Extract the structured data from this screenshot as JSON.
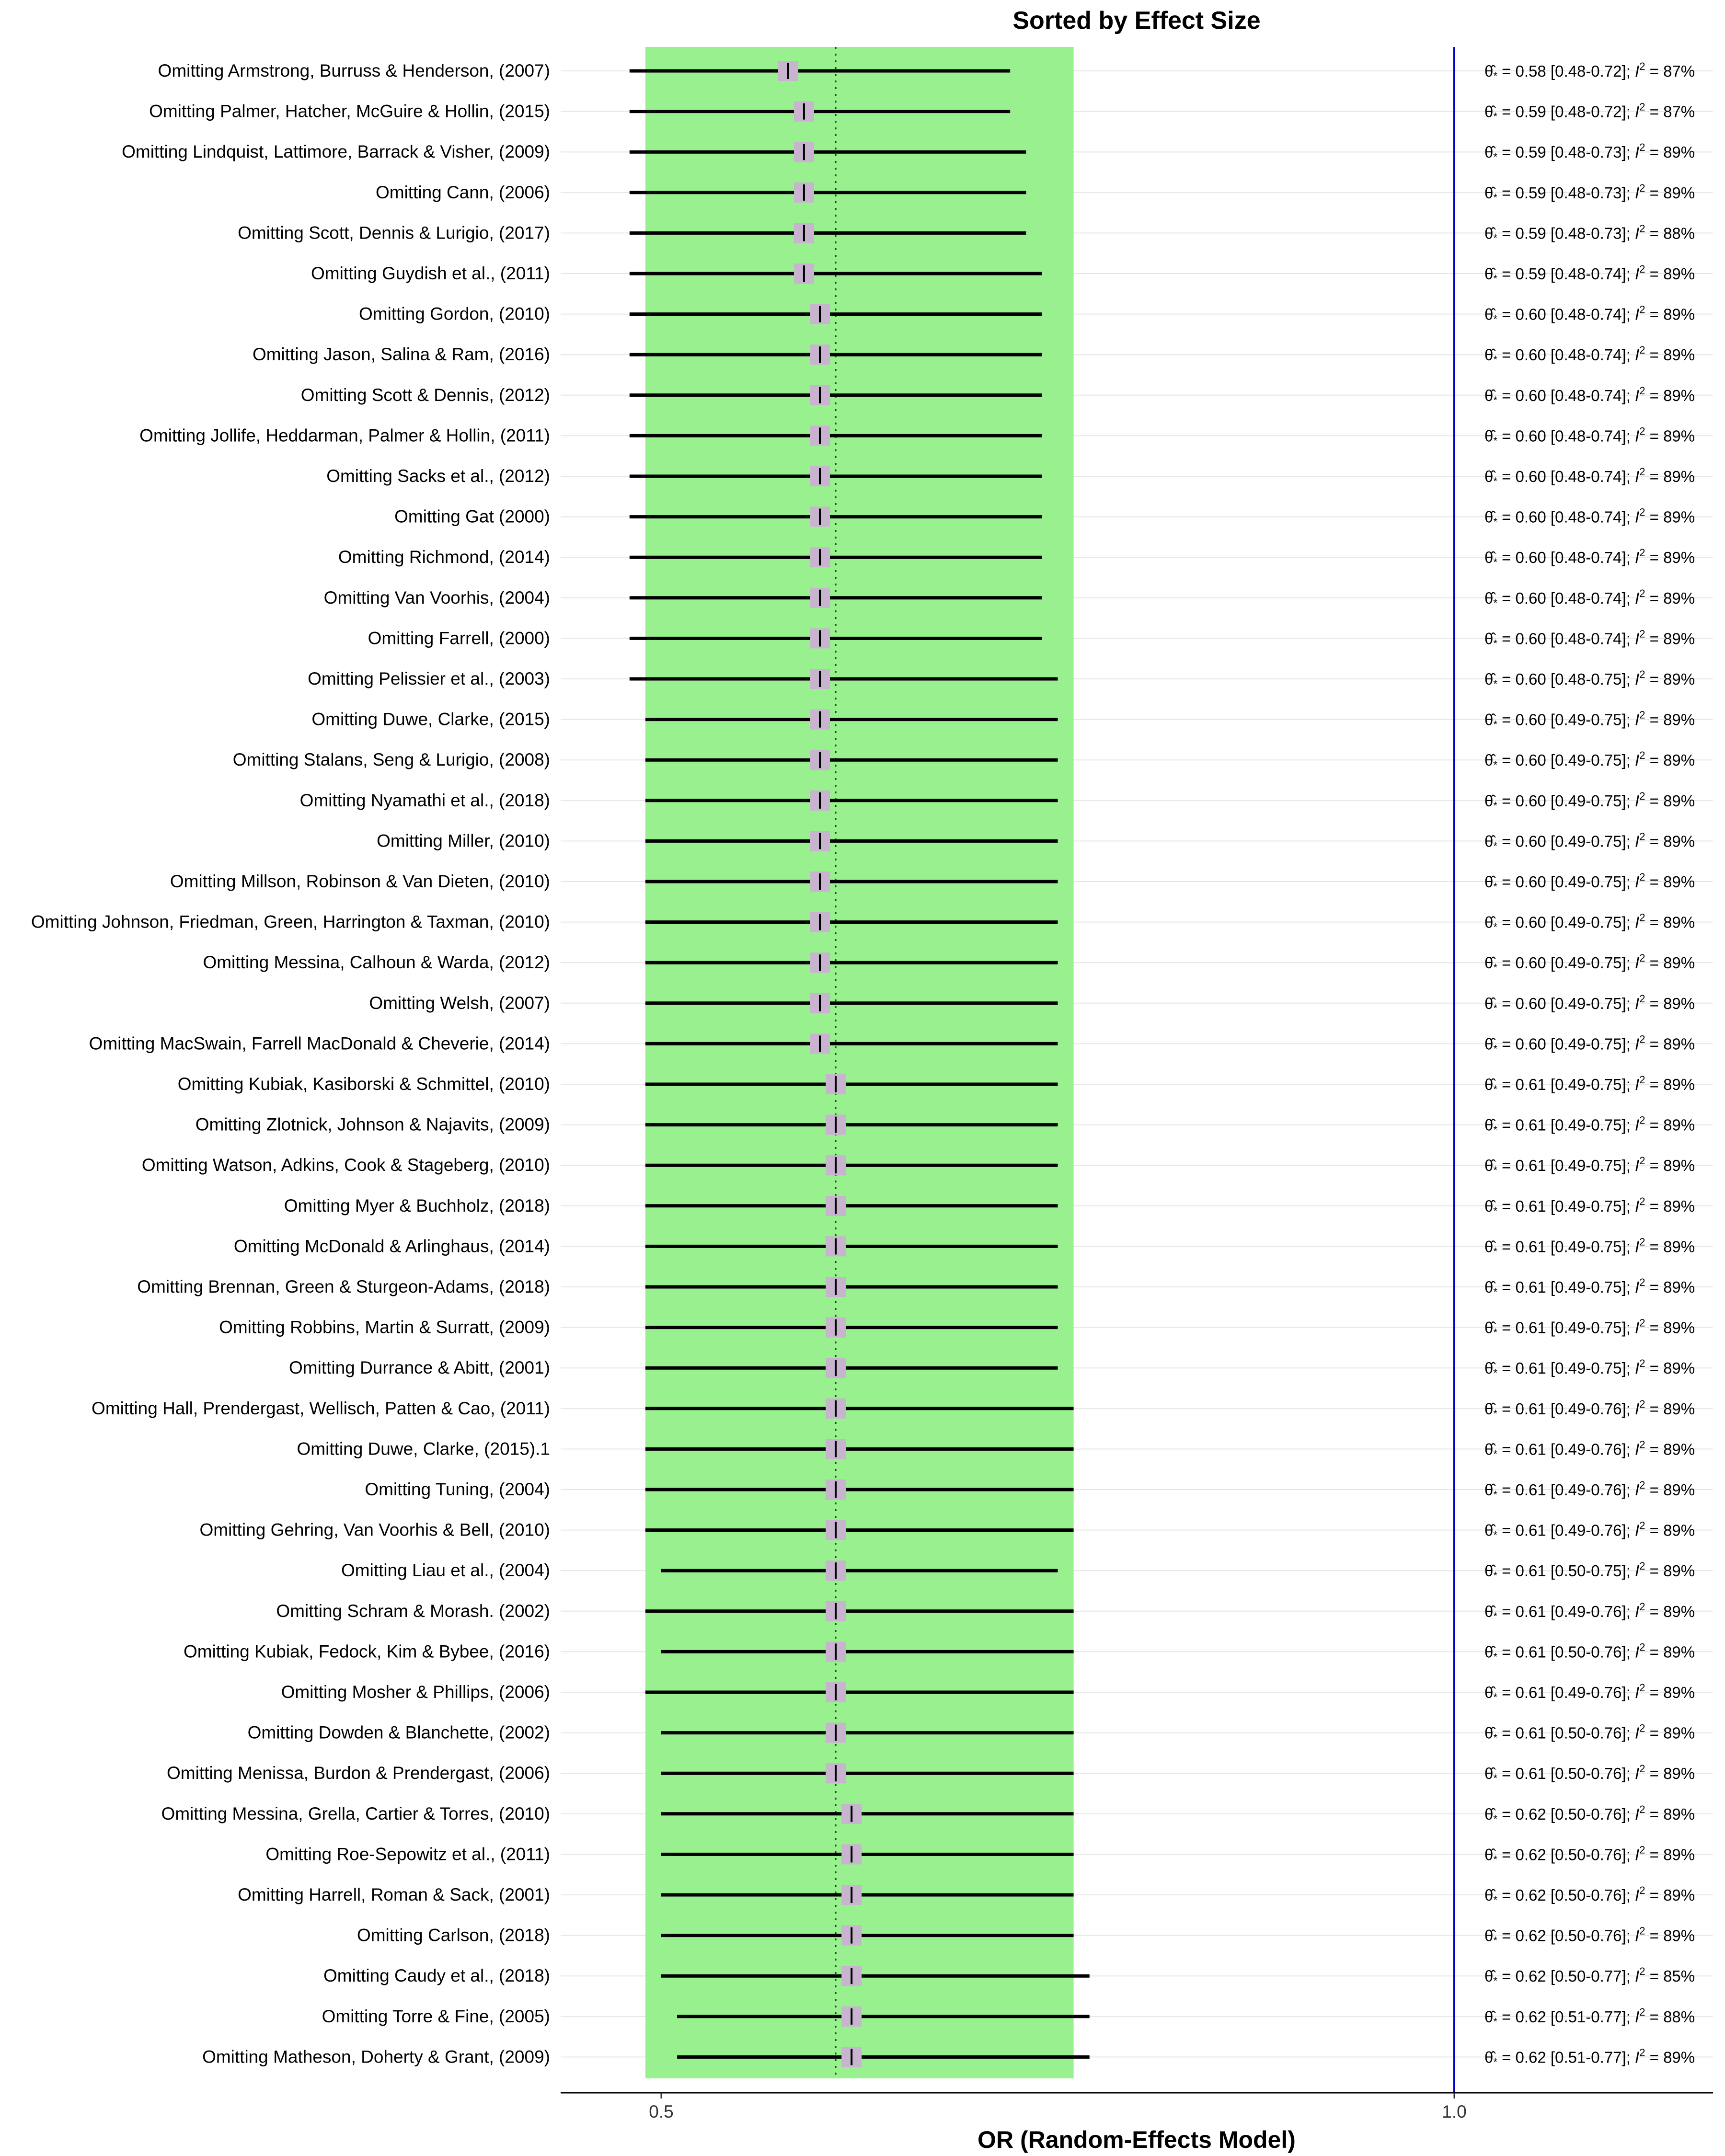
{
  "chart_data": {
    "type": "forest",
    "title": "Sorted by Effect Size",
    "xlabel": "OR (Random-Effects Model)",
    "xlim": [
      0.4,
      1.33
    ],
    "xticks": [
      0.5,
      1.0
    ],
    "xtick_labels": [
      "0.5",
      "1.0"
    ],
    "pooled_estimate": 0.61,
    "pooled_ci": [
      0.49,
      0.76
    ],
    "null_line": 1.0,
    "colors": {
      "ci_band": "#98f08f",
      "null_line": "#0000cc",
      "point_box": "#c8b4cf",
      "ci_line": "#000000",
      "gridline": "#e6e6e6"
    },
    "rows": [
      {
        "label": "Omitting Armstrong, Burruss & Henderson, (2007)",
        "est": 0.58,
        "lo": 0.48,
        "hi": 0.72,
        "i2": "87%"
      },
      {
        "label": "Omitting Palmer, Hatcher, McGuire & Hollin, (2015)",
        "est": 0.59,
        "lo": 0.48,
        "hi": 0.72,
        "i2": "87%"
      },
      {
        "label": "Omitting Lindquist, Lattimore, Barrack & Visher, (2009)",
        "est": 0.59,
        "lo": 0.48,
        "hi": 0.73,
        "i2": "89%"
      },
      {
        "label": "Omitting Cann, (2006)",
        "est": 0.59,
        "lo": 0.48,
        "hi": 0.73,
        "i2": "89%"
      },
      {
        "label": "Omitting Scott, Dennis & Lurigio, (2017)",
        "est": 0.59,
        "lo": 0.48,
        "hi": 0.73,
        "i2": "88%"
      },
      {
        "label": "Omitting Guydish et al., (2011)",
        "est": 0.59,
        "lo": 0.48,
        "hi": 0.74,
        "i2": "89%"
      },
      {
        "label": "Omitting Gordon, (2010)",
        "est": 0.6,
        "lo": 0.48,
        "hi": 0.74,
        "i2": "89%"
      },
      {
        "label": "Omitting Jason, Salina & Ram, (2016)",
        "est": 0.6,
        "lo": 0.48,
        "hi": 0.74,
        "i2": "89%"
      },
      {
        "label": "Omitting Scott & Dennis, (2012)",
        "est": 0.6,
        "lo": 0.48,
        "hi": 0.74,
        "i2": "89%"
      },
      {
        "label": "Omitting Jollife, Heddarman, Palmer & Hollin, (2011)",
        "est": 0.6,
        "lo": 0.48,
        "hi": 0.74,
        "i2": "89%"
      },
      {
        "label": "Omitting Sacks et al., (2012)",
        "est": 0.6,
        "lo": 0.48,
        "hi": 0.74,
        "i2": "89%"
      },
      {
        "label": "Omitting Gat (2000)",
        "est": 0.6,
        "lo": 0.48,
        "hi": 0.74,
        "i2": "89%"
      },
      {
        "label": "Omitting Richmond, (2014)",
        "est": 0.6,
        "lo": 0.48,
        "hi": 0.74,
        "i2": "89%"
      },
      {
        "label": "Omitting Van Voorhis, (2004)",
        "est": 0.6,
        "lo": 0.48,
        "hi": 0.74,
        "i2": "89%"
      },
      {
        "label": "Omitting Farrell, (2000)",
        "est": 0.6,
        "lo": 0.48,
        "hi": 0.74,
        "i2": "89%"
      },
      {
        "label": "Omitting Pelissier et al., (2003)",
        "est": 0.6,
        "lo": 0.48,
        "hi": 0.75,
        "i2": "89%"
      },
      {
        "label": "Omitting Duwe, Clarke, (2015)",
        "est": 0.6,
        "lo": 0.49,
        "hi": 0.75,
        "i2": "89%"
      },
      {
        "label": "Omitting Stalans, Seng & Lurigio, (2008)",
        "est": 0.6,
        "lo": 0.49,
        "hi": 0.75,
        "i2": "89%"
      },
      {
        "label": "Omitting Nyamathi et al., (2018)",
        "est": 0.6,
        "lo": 0.49,
        "hi": 0.75,
        "i2": "89%"
      },
      {
        "label": "Omitting Miller, (2010)",
        "est": 0.6,
        "lo": 0.49,
        "hi": 0.75,
        "i2": "89%"
      },
      {
        "label": "Omitting Millson, Robinson & Van Dieten, (2010)",
        "est": 0.6,
        "lo": 0.49,
        "hi": 0.75,
        "i2": "89%"
      },
      {
        "label": "Omitting Johnson, Friedman, Green, Harrington & Taxman, (2010)",
        "est": 0.6,
        "lo": 0.49,
        "hi": 0.75,
        "i2": "89%"
      },
      {
        "label": "Omitting Messina, Calhoun & Warda, (2012)",
        "est": 0.6,
        "lo": 0.49,
        "hi": 0.75,
        "i2": "89%"
      },
      {
        "label": "Omitting Welsh, (2007)",
        "est": 0.6,
        "lo": 0.49,
        "hi": 0.75,
        "i2": "89%"
      },
      {
        "label": "Omitting MacSwain, Farrell MacDonald & Cheverie, (2014)",
        "est": 0.6,
        "lo": 0.49,
        "hi": 0.75,
        "i2": "89%"
      },
      {
        "label": "Omitting Kubiak, Kasiborski & Schmittel, (2010)",
        "est": 0.61,
        "lo": 0.49,
        "hi": 0.75,
        "i2": "89%"
      },
      {
        "label": "Omitting Zlotnick, Johnson & Najavits, (2009)",
        "est": 0.61,
        "lo": 0.49,
        "hi": 0.75,
        "i2": "89%"
      },
      {
        "label": "Omitting Watson, Adkins, Cook & Stageberg, (2010)",
        "est": 0.61,
        "lo": 0.49,
        "hi": 0.75,
        "i2": "89%"
      },
      {
        "label": "Omitting Myer & Buchholz, (2018)",
        "est": 0.61,
        "lo": 0.49,
        "hi": 0.75,
        "i2": "89%"
      },
      {
        "label": "Omitting McDonald & Arlinghaus, (2014)",
        "est": 0.61,
        "lo": 0.49,
        "hi": 0.75,
        "i2": "89%"
      },
      {
        "label": "Omitting Brennan, Green & Sturgeon-Adams, (2018)",
        "est": 0.61,
        "lo": 0.49,
        "hi": 0.75,
        "i2": "89%"
      },
      {
        "label": "Omitting Robbins, Martin & Surratt, (2009)",
        "est": 0.61,
        "lo": 0.49,
        "hi": 0.75,
        "i2": "89%"
      },
      {
        "label": "Omitting Durrance & Abitt, (2001)",
        "est": 0.61,
        "lo": 0.49,
        "hi": 0.75,
        "i2": "89%"
      },
      {
        "label": "Omitting Hall, Prendergast, Wellisch, Patten & Cao, (2011)",
        "est": 0.61,
        "lo": 0.49,
        "hi": 0.76,
        "i2": "89%"
      },
      {
        "label": "Omitting Duwe, Clarke, (2015).1",
        "est": 0.61,
        "lo": 0.49,
        "hi": 0.76,
        "i2": "89%"
      },
      {
        "label": "Omitting Tuning, (2004)",
        "est": 0.61,
        "lo": 0.49,
        "hi": 0.76,
        "i2": "89%"
      },
      {
        "label": "Omitting Gehring, Van Voorhis & Bell, (2010)",
        "est": 0.61,
        "lo": 0.49,
        "hi": 0.76,
        "i2": "89%"
      },
      {
        "label": "Omitting Liau et al., (2004)",
        "est": 0.61,
        "lo": 0.5,
        "hi": 0.75,
        "i2": "89%"
      },
      {
        "label": "Omitting Schram & Morash. (2002)",
        "est": 0.61,
        "lo": 0.49,
        "hi": 0.76,
        "i2": "89%"
      },
      {
        "label": "Omitting Kubiak, Fedock, Kim & Bybee, (2016)",
        "est": 0.61,
        "lo": 0.5,
        "hi": 0.76,
        "i2": "89%"
      },
      {
        "label": "Omitting Mosher & Phillips, (2006)",
        "est": 0.61,
        "lo": 0.49,
        "hi": 0.76,
        "i2": "89%"
      },
      {
        "label": "Omitting Dowden & Blanchette, (2002)",
        "est": 0.61,
        "lo": 0.5,
        "hi": 0.76,
        "i2": "89%"
      },
      {
        "label": "Omitting Menissa, Burdon & Prendergast, (2006)",
        "est": 0.61,
        "lo": 0.5,
        "hi": 0.76,
        "i2": "89%"
      },
      {
        "label": "Omitting Messina, Grella, Cartier & Torres, (2010)",
        "est": 0.62,
        "lo": 0.5,
        "hi": 0.76,
        "i2": "89%"
      },
      {
        "label": "Omitting Roe-Sepowitz et al., (2011)",
        "est": 0.62,
        "lo": 0.5,
        "hi": 0.76,
        "i2": "89%"
      },
      {
        "label": "Omitting Harrell, Roman & Sack, (2001)",
        "est": 0.62,
        "lo": 0.5,
        "hi": 0.76,
        "i2": "89%"
      },
      {
        "label": "Omitting Carlson, (2018)",
        "est": 0.62,
        "lo": 0.5,
        "hi": 0.76,
        "i2": "89%"
      },
      {
        "label": "Omitting Caudy et al., (2018)",
        "est": 0.62,
        "lo": 0.5,
        "hi": 0.77,
        "i2": "85%"
      },
      {
        "label": "Omitting Torre & Fine, (2005)",
        "est": 0.62,
        "lo": 0.51,
        "hi": 0.77,
        "i2": "88%"
      },
      {
        "label": "Omitting Matheson, Doherty & Grant, (2009)",
        "est": 0.62,
        "lo": 0.51,
        "hi": 0.77,
        "i2": "89%"
      }
    ]
  }
}
